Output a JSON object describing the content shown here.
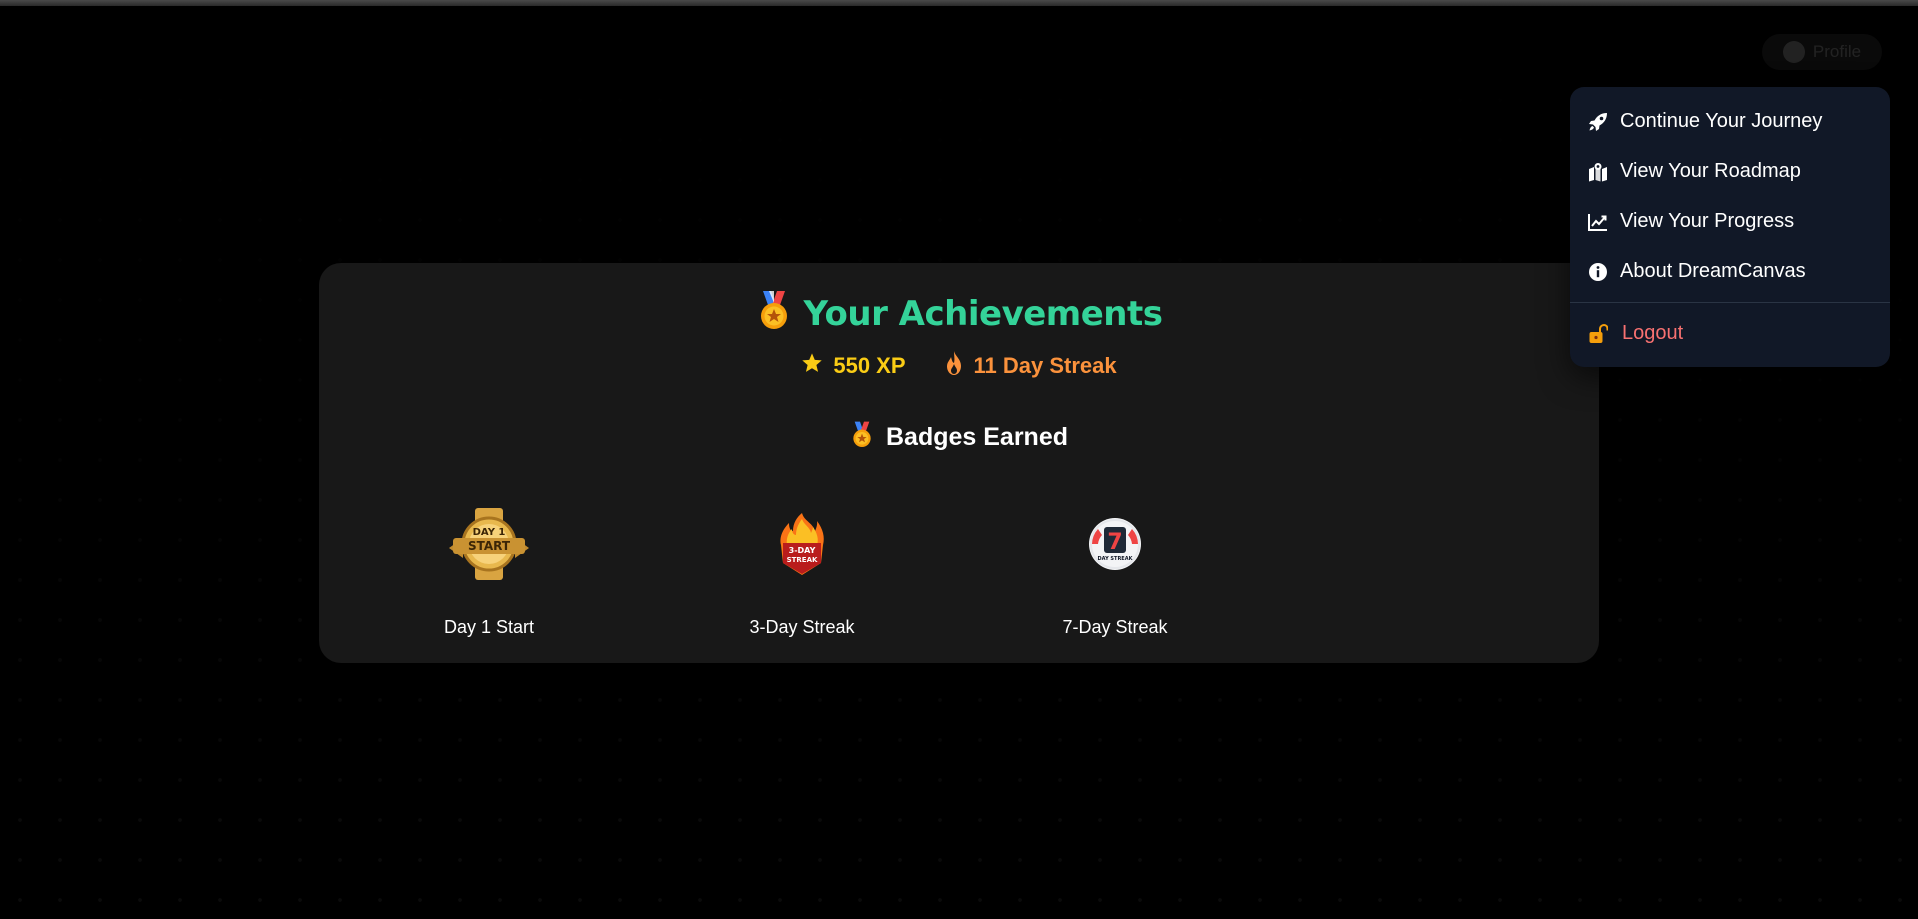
{
  "header": {
    "profile_label": "Profile"
  },
  "menu": {
    "items": [
      {
        "label": "Continue Your Journey",
        "icon": "rocket-icon"
      },
      {
        "label": "View Your Roadmap",
        "icon": "map-icon"
      },
      {
        "label": "View Your Progress",
        "icon": "chart-line-icon"
      },
      {
        "label": "About DreamCanvas",
        "icon": "info-icon"
      }
    ],
    "logout_label": "Logout"
  },
  "achievements": {
    "title": "Your Achievements",
    "xp": "550 XP",
    "streak": "11 Day Streak",
    "badges_heading": "Badges Earned",
    "badges": [
      {
        "label": "Day 1 Start",
        "art_text": [
          "DAY 1",
          "START"
        ]
      },
      {
        "label": "3-Day Streak",
        "art_text": [
          "3-DAY",
          "STREAK"
        ]
      },
      {
        "label": "7-Day Streak",
        "art_text": [
          "7",
          "DAY STREAK"
        ]
      }
    ]
  },
  "colors": {
    "title": "#34d399",
    "xp": "#facc15",
    "streak": "#fb923c",
    "logout": "#f87171",
    "menu_bg": "#111827",
    "card_bg": "#181818"
  }
}
